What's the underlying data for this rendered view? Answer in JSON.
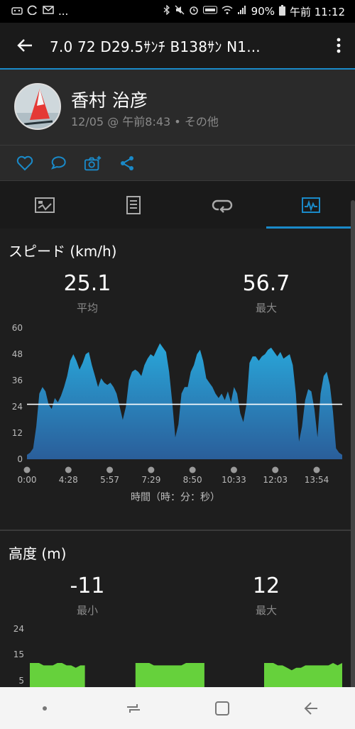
{
  "status_bar": {
    "left_icons": [
      "android-icon",
      "sync-icon",
      "mail-icon"
    ],
    "ellipsis": "...",
    "battery": "90%",
    "time": "午前 11:12"
  },
  "app_bar": {
    "title": "7.0  72  D29.5ｻﾝﾁ  B138ｻﾝ  N1..."
  },
  "profile": {
    "name": "香村 治彦",
    "meta": "12/05 @ 午前8:43 • その他"
  },
  "actions": [
    "like-icon",
    "comment-icon",
    "add-photo-icon",
    "share-icon"
  ],
  "tabs": [
    "overview-icon",
    "details-icon",
    "laps-icon",
    "charts-icon"
  ],
  "colors": {
    "accent": "#1a8ac9",
    "speed_fill_top": "#29a7da",
    "speed_fill_bottom": "#2a5e9a",
    "altitude_fill": "#66d13c"
  },
  "speed": {
    "title": "スピード (km/h)",
    "avg_value": "25.1",
    "avg_label": "平均",
    "max_value": "56.7",
    "max_label": "最大",
    "xlabel": "時間（時：分：秒）"
  },
  "altitude": {
    "title": "高度 (m)",
    "min_value": "-11",
    "min_label": "最小",
    "max_value": "12",
    "max_label": "最大"
  },
  "chart_data": [
    {
      "type": "area",
      "ylim": [
        0,
        60
      ],
      "y_ticks": [
        "60",
        "48",
        "36",
        "24",
        "12",
        "0"
      ],
      "x_ticks": [
        "0:00",
        "4:28",
        "5:57",
        "7:29",
        "8:50",
        "10:33",
        "12:03",
        "13:54"
      ],
      "average_line": 25.1,
      "values": [
        2,
        3,
        5,
        15,
        30,
        33,
        31,
        25,
        23,
        28,
        26,
        29,
        33,
        38,
        45,
        48,
        45,
        41,
        44,
        48,
        49,
        43,
        38,
        33,
        37,
        35,
        34,
        35,
        33,
        30,
        24,
        18,
        24,
        36,
        40,
        41,
        40,
        38,
        43,
        46,
        48,
        47,
        50,
        53,
        51,
        49,
        40,
        26,
        10,
        16,
        30,
        33,
        33,
        40,
        43,
        48,
        50,
        45,
        37,
        35,
        33,
        30,
        28,
        30,
        27,
        31,
        26,
        33,
        30,
        21,
        17,
        25,
        44,
        47,
        47,
        45,
        47,
        48,
        50,
        51,
        49,
        47,
        49,
        46,
        47,
        48,
        43,
        30,
        8,
        15,
        27,
        32,
        31,
        23,
        10,
        30,
        38,
        40,
        34,
        22,
        5,
        3,
        2
      ]
    },
    {
      "type": "area",
      "y_ticks": [
        "24",
        "15",
        "5"
      ],
      "values": [
        10,
        10,
        10,
        9,
        9,
        9,
        10,
        10,
        9,
        9,
        8,
        9,
        9,
        null,
        null,
        null,
        null,
        null,
        null,
        null,
        null,
        null,
        null,
        10,
        10,
        10,
        10,
        9,
        9,
        9,
        9,
        9,
        9,
        9,
        10,
        10,
        10,
        10,
        10,
        null,
        null,
        null,
        null,
        null,
        null,
        null,
        null,
        null,
        null,
        null,
        null,
        10,
        10,
        10,
        9,
        9,
        8,
        7,
        8,
        8,
        9,
        9,
        9,
        9,
        9,
        9,
        10,
        9,
        10
      ]
    }
  ]
}
